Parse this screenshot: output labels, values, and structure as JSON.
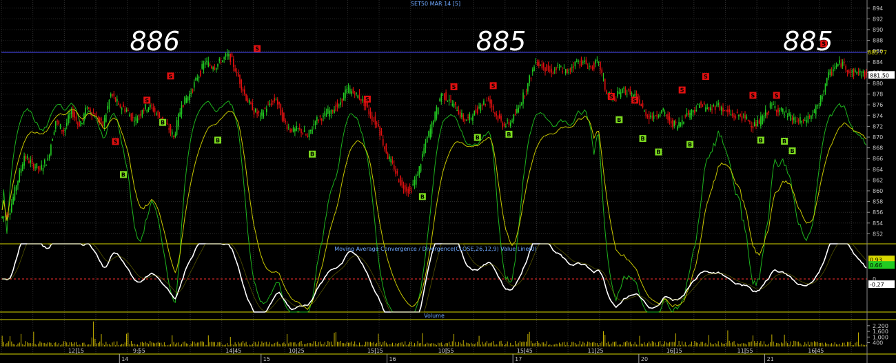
{
  "chart_data": {
    "type": "candlestick",
    "title": "SET50 MAR 14  [5]",
    "colors": {
      "up": "#22cc22",
      "down": "#e01010",
      "grid": "#2e2e2e",
      "resistance": "#4b4bff",
      "panel_border": "#d8d800",
      "zero": "#ff3030",
      "macd": "#ffffff",
      "sig_green": "#1db41d",
      "sig_yellow": "#c8c800",
      "volume": "#c8b400"
    },
    "price_panel": {
      "ylim": [
        850,
        895
      ],
      "yticks": [
        "894",
        "892",
        "890",
        "888",
        "886",
        "884",
        "882",
        "880",
        "878",
        "876",
        "874",
        "872",
        "870",
        "868",
        "866",
        "864",
        "862",
        "860",
        "858",
        "856",
        "854",
        "852"
      ],
      "last_price": "881.50",
      "resistance": {
        "label": "885.77",
        "value": 885.77
      },
      "annotations": [
        {
          "text": "886",
          "x": 19
        },
        {
          "text": "885",
          "x": 63
        },
        {
          "text": "885",
          "x": 102
        }
      ],
      "close": [
        855.5,
        861,
        866.5,
        865,
        864,
        866,
        873,
        871,
        875,
        872,
        875.5,
        874,
        872,
        878,
        876,
        875,
        873,
        875,
        876,
        874,
        872.5,
        870,
        876,
        878,
        881,
        884,
        883,
        884,
        885.5,
        882,
        878,
        875,
        874,
        876,
        877,
        873,
        871,
        871.5,
        870,
        873,
        874,
        875,
        876,
        879,
        878,
        877,
        874,
        872,
        867,
        864,
        861,
        860,
        863,
        869,
        873,
        878,
        877,
        875,
        873,
        874,
        876,
        877,
        874,
        872,
        873,
        876,
        880,
        884,
        883,
        882,
        883,
        882,
        884,
        884,
        883,
        884,
        878,
        877,
        879,
        878,
        877,
        874,
        874,
        875,
        873,
        872,
        874,
        875,
        876,
        875,
        876,
        875,
        874,
        874,
        873,
        872,
        874,
        876,
        875,
        874,
        873,
        873,
        874,
        876,
        881,
        883,
        884,
        882,
        882,
        881.5
      ],
      "signals": [
        {
          "t": "S",
          "x": 14,
          "p": 868.4
        },
        {
          "t": "B",
          "x": 15,
          "p": 863.8
        },
        {
          "t": "S",
          "x": 18,
          "p": 876.1
        },
        {
          "t": "B",
          "x": 20,
          "p": 873.5
        },
        {
          "t": "S",
          "x": 21,
          "p": 880.6
        },
        {
          "t": "B",
          "x": 27,
          "p": 870.2
        },
        {
          "t": "S",
          "x": 32,
          "p": 885.7
        },
        {
          "t": "B",
          "x": 39,
          "p": 867.6
        },
        {
          "t": "S",
          "x": 46,
          "p": 876.3
        },
        {
          "t": "B",
          "x": 53,
          "p": 859.7
        },
        {
          "t": "S",
          "x": 57,
          "p": 878.6
        },
        {
          "t": "B",
          "x": 60,
          "p": 870.7
        },
        {
          "t": "S",
          "x": 62,
          "p": 878.8
        },
        {
          "t": "B",
          "x": 64,
          "p": 871.3
        },
        {
          "t": "S",
          "x": 77,
          "p": 876.8
        },
        {
          "t": "B",
          "x": 78,
          "p": 874.0
        },
        {
          "t": "S",
          "x": 80,
          "p": 876.1
        },
        {
          "t": "B",
          "x": 81,
          "p": 870.5
        },
        {
          "t": "B",
          "x": 83,
          "p": 868.0
        },
        {
          "t": "S",
          "x": 86,
          "p": 878.0
        },
        {
          "t": "B",
          "x": 87,
          "p": 869.4
        },
        {
          "t": "S",
          "x": 89,
          "p": 880.5
        },
        {
          "t": "S",
          "x": 95,
          "p": 877.0
        },
        {
          "t": "B",
          "x": 96,
          "p": 870.2
        },
        {
          "t": "S",
          "x": 98,
          "p": 877.0
        },
        {
          "t": "B",
          "x": 99,
          "p": 870.0
        },
        {
          "t": "B",
          "x": 100,
          "p": 868.2
        },
        {
          "t": "S",
          "x": 104,
          "p": 886.6
        }
      ]
    },
    "macd_panel": {
      "label": "Moving Average Convergence / Divergence(CLOSE,26,12,9) Value Line(0)",
      "ylim": [
        -1.6,
        1.7
      ],
      "yticks": [
        "0.93",
        "0.66",
        "0",
        "-0.27"
      ],
      "value_labels": [
        {
          "text": "0.93",
          "value": 0.93,
          "color": "#d8d800"
        },
        {
          "text": "0.66",
          "value": 0.66,
          "color": "#22cc22"
        },
        {
          "text": "-0.27",
          "value": -0.27,
          "color": "#ffffff"
        }
      ]
    },
    "volume_panel": {
      "label": "Volume",
      "ylim": [
        0,
        2700
      ],
      "yticks": [
        "2,200",
        "1,600",
        "1,000",
        "400"
      ],
      "tick_values": [
        2200,
        1600,
        1000,
        400
      ]
    },
    "x_axis": {
      "time_labels": [
        {
          "text": "12:15",
          "x": 9
        },
        {
          "text": "9:55",
          "x": 17
        },
        {
          "text": "14:45",
          "x": 29
        },
        {
          "text": "10:25",
          "x": 37
        },
        {
          "text": "15:15",
          "x": 47
        },
        {
          "text": "10:55",
          "x": 56
        },
        {
          "text": "15:45",
          "x": 66
        },
        {
          "text": "11:25",
          "x": 75
        },
        {
          "text": "16:15",
          "x": 85
        },
        {
          "text": "11:55",
          "x": 94
        },
        {
          "text": "16:45",
          "x": 103
        }
      ],
      "date_labels": [
        {
          "text": "14",
          "x": 15
        },
        {
          "text": "15",
          "x": 33
        },
        {
          "text": "16",
          "x": 49
        },
        {
          "text": "17",
          "x": 65
        },
        {
          "text": "20",
          "x": 81
        },
        {
          "text": "21",
          "x": 97
        }
      ]
    }
  }
}
